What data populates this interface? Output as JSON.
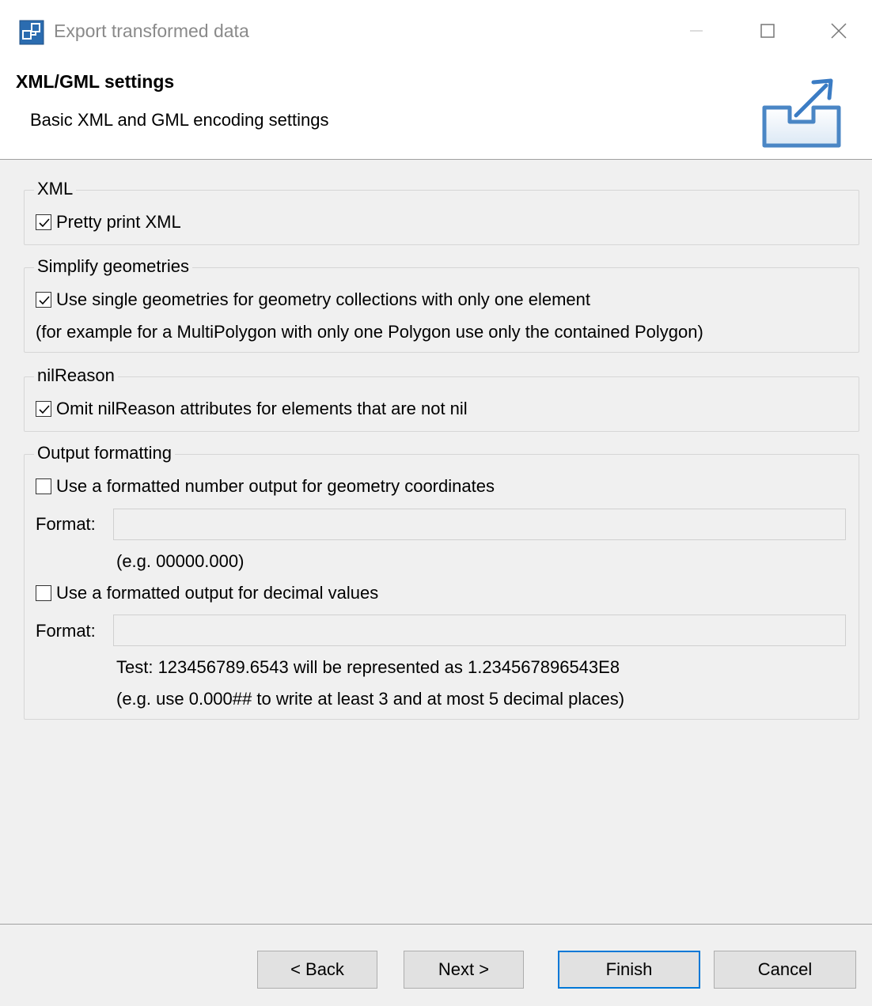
{
  "window": {
    "title": "Export transformed data",
    "controls": [
      "minimize",
      "maximize",
      "close"
    ]
  },
  "header": {
    "title": "XML/GML settings",
    "description": "Basic XML and GML encoding settings",
    "banner_icon": "export-icon"
  },
  "groups": {
    "xml": {
      "legend": "XML",
      "pretty_print": {
        "label": "Pretty print XML",
        "checked": true
      }
    },
    "simplify": {
      "legend": "Simplify geometries",
      "single_geometries": {
        "label": "Use single geometries for geometry collections with only one element",
        "checked": true
      },
      "note": "(for example for a MultiPolygon with only one Polygon use only the contained Polygon)"
    },
    "nilreason": {
      "legend": "nilReason",
      "omit": {
        "label": "Omit nilReason attributes for elements that are not nil",
        "checked": true
      }
    },
    "output": {
      "legend": "Output formatting",
      "coord_format": {
        "label": "Use a formatted number output for geometry coordinates",
        "checked": false
      },
      "coord_format_label": "Format:",
      "coord_format_value": "",
      "coord_example": "(e.g. 00000.000)",
      "decimal_format": {
        "label": "Use a formatted output for decimal values",
        "checked": false
      },
      "decimal_format_label": "Format:",
      "decimal_format_value": "",
      "decimal_test": "Test: 123456789.6543 will be represented as 1.234567896543E8",
      "decimal_example": "(e.g. use 0.000## to write at least 3 and at most 5 decimal places)"
    }
  },
  "buttons": {
    "back": "< Back",
    "next": "Next >",
    "finish": "Finish",
    "cancel": "Cancel"
  },
  "colors": {
    "focus_border": "#0078d7",
    "background": "#f0f0f0",
    "header_background": "#ffffff"
  }
}
